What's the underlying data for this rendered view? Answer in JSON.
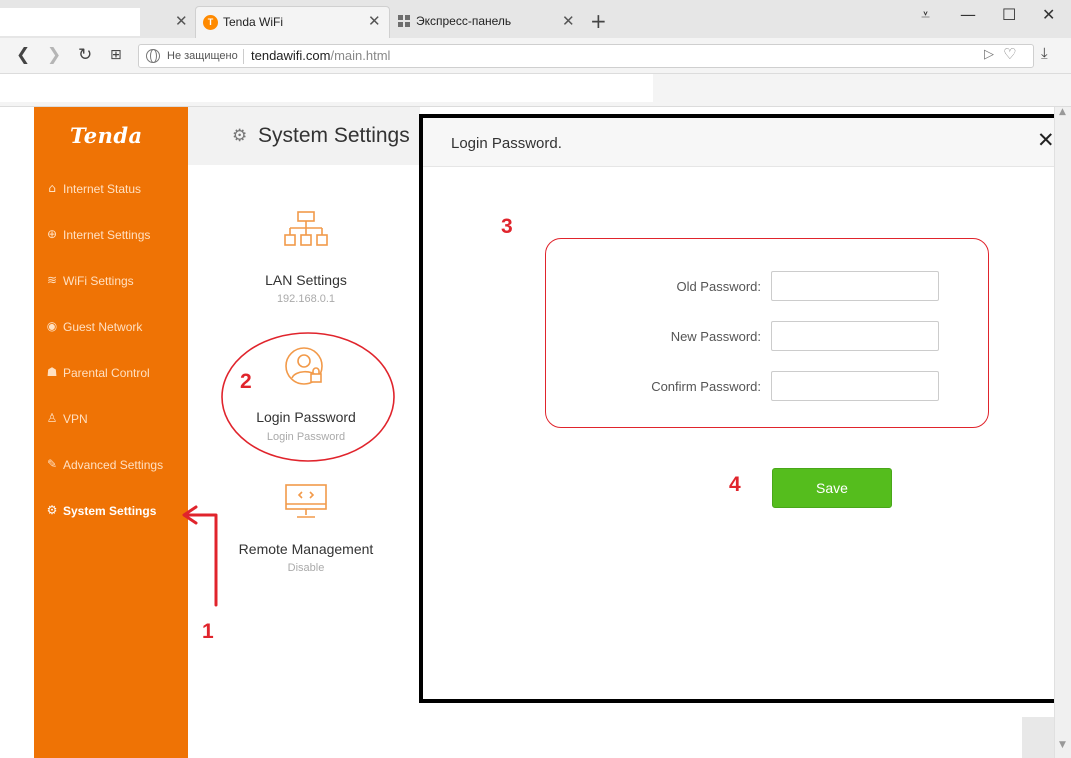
{
  "browser": {
    "tabs": [
      {
        "label": ""
      },
      {
        "label": "Tenda WiFi",
        "favicon": "tenda-favicon"
      },
      {
        "label": "Экспресс-панель",
        "icon": "grid-icon"
      }
    ],
    "new_tab": "+",
    "window_controls": {
      "menu": "⩡",
      "minimize": "—",
      "maximize": "☐",
      "close": "✕"
    },
    "address": {
      "security_label": "Не защищено",
      "host": "tendawifi.com",
      "path": "/main.html"
    }
  },
  "sidebar": {
    "logo": "Tenda",
    "accent_color": "#ef7305",
    "items": [
      {
        "label": "Internet Status",
        "icon": "router-icon"
      },
      {
        "label": "Internet Settings",
        "icon": "globe-icon"
      },
      {
        "label": "WiFi Settings",
        "icon": "wifi-icon"
      },
      {
        "label": "Guest Network",
        "icon": "guest-icon"
      },
      {
        "label": "Parental Control",
        "icon": "parental-icon"
      },
      {
        "label": "VPN",
        "icon": "vpn-icon"
      },
      {
        "label": "Advanced Settings",
        "icon": "wrench-icon"
      },
      {
        "label": "System Settings",
        "icon": "gear-icon",
        "active": true
      }
    ]
  },
  "header": {
    "title": "System Settings"
  },
  "cards": [
    {
      "title": "LAN Settings",
      "subtitle": "192.168.0.1"
    },
    {
      "title": "Login Password",
      "subtitle": "Login Password"
    },
    {
      "title": "Remote Management",
      "subtitle": "Disable"
    }
  ],
  "dialog": {
    "title": "Login Password.",
    "close": "✕",
    "fields": [
      {
        "label": "Old Password:",
        "value": ""
      },
      {
        "label": "New Password:",
        "value": ""
      },
      {
        "label": "Confirm Password:",
        "value": ""
      }
    ],
    "save_label": "Save",
    "save_color": "#55bd1d"
  },
  "annotations": {
    "n1": "1",
    "n2": "2",
    "n3": "3",
    "n4": "4",
    "color": "#e0242c"
  }
}
